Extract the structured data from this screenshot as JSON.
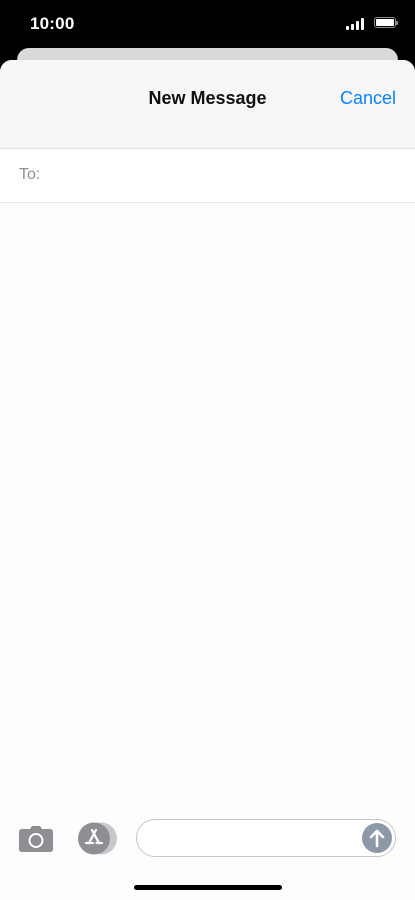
{
  "status_bar": {
    "time": "10:00",
    "signal_icon": "cellular-signal-icon",
    "wifi_icon": "wifi-icon",
    "battery_icon": "battery-icon",
    "battery_level": 1.0
  },
  "nav": {
    "title": "New Message",
    "cancel_label": "Cancel"
  },
  "recipient": {
    "label": "To:",
    "value": "",
    "placeholder": ""
  },
  "composer": {
    "camera_icon": "camera-icon",
    "appstore_icon": "app-store-icon",
    "message_value": "",
    "message_placeholder": "",
    "send_icon": "send-arrow-up-icon"
  },
  "colors": {
    "accent": "#0a84ff",
    "label_gray": "#8e8e93",
    "icon_gray": "#8e8e93",
    "send_disabled": "#8e99a8"
  }
}
